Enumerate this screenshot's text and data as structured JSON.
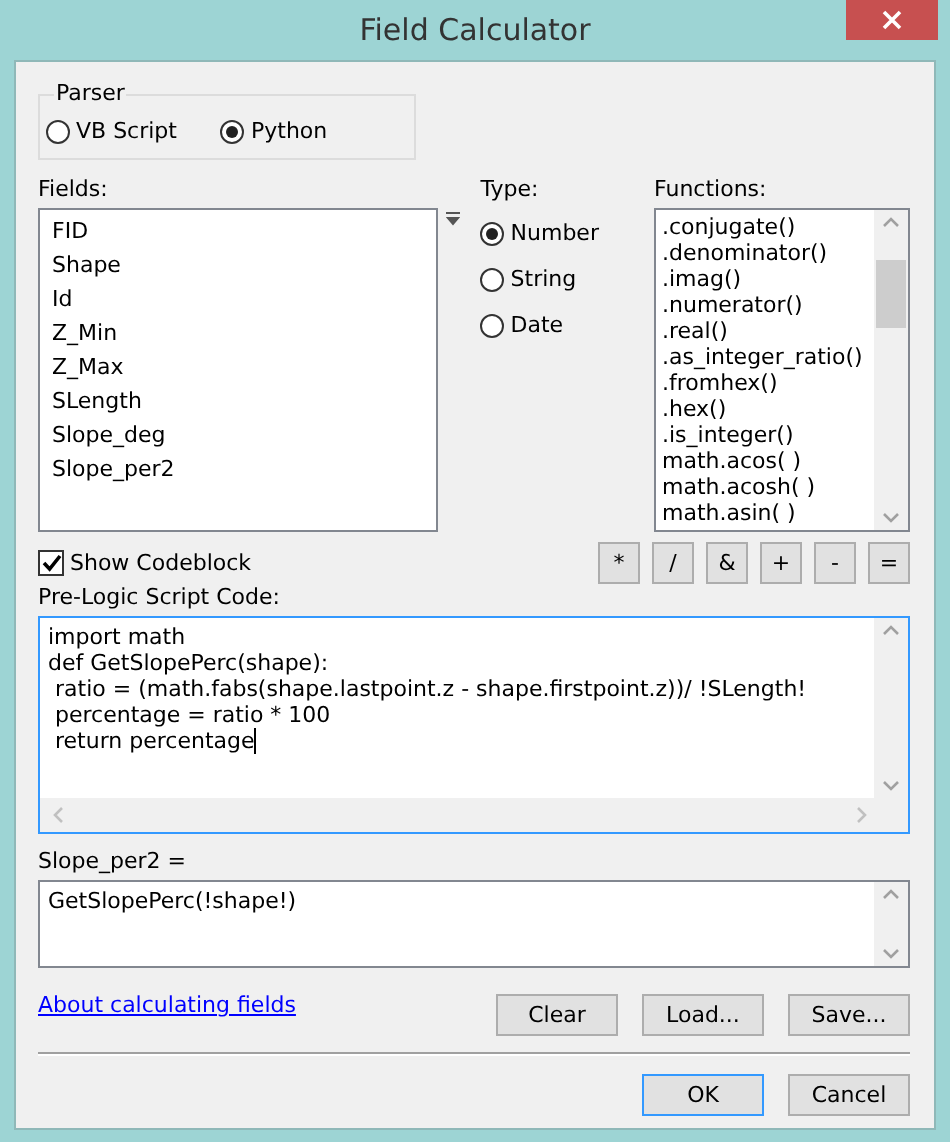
{
  "window": {
    "title": "Field Calculator"
  },
  "parser": {
    "label": "Parser",
    "options": [
      {
        "label": "VB Script",
        "selected": false
      },
      {
        "label": "Python",
        "selected": true
      }
    ]
  },
  "fields": {
    "label": "Fields:",
    "items": [
      "FID",
      "Shape",
      "Id",
      "Z_Min",
      "Z_Max",
      "SLength",
      "Slope_deg",
      "Slope_per2"
    ]
  },
  "type": {
    "label": "Type:",
    "options": [
      {
        "label": "Number",
        "selected": true
      },
      {
        "label": "String",
        "selected": false
      },
      {
        "label": "Date",
        "selected": false
      }
    ]
  },
  "functions": {
    "label": "Functions:",
    "items": [
      ".conjugate()",
      ".denominator()",
      ".imag()",
      ".numerator()",
      ".real()",
      ".as_integer_ratio()",
      ".fromhex()",
      ".hex()",
      ".is_integer()",
      "math.acos( )",
      "math.acosh( )",
      "math.asin( )"
    ]
  },
  "show_codeblock": {
    "label": "Show Codeblock",
    "checked": true
  },
  "operators": [
    "*",
    "/",
    "&",
    "+",
    "-",
    "="
  ],
  "pre_logic": {
    "label": "Pre-Logic Script Code:",
    "lines": [
      "import math",
      "def GetSlopePerc(shape):",
      " ratio = (math.fabs(shape.lastpoint.z - shape.firstpoint.z))/ !SLength!",
      " percentage = ratio * 100",
      " return percentage"
    ]
  },
  "expression": {
    "label": "Slope_per2 =",
    "value": "GetSlopePerc(!shape!)"
  },
  "help_link": "About calculating fields",
  "file_buttons": [
    "Clear",
    "Load...",
    "Save..."
  ],
  "dialog_buttons": [
    {
      "label": "OK",
      "default": true
    },
    {
      "label": "Cancel",
      "default": false
    }
  ]
}
